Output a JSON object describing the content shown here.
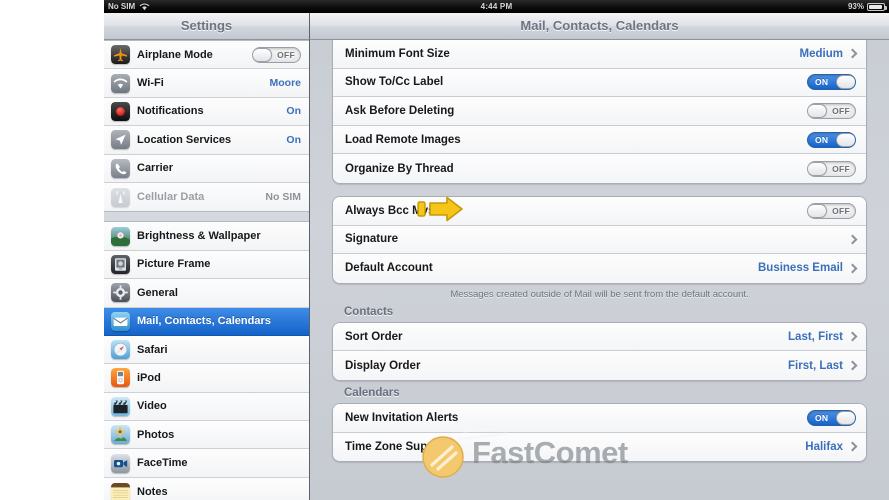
{
  "statusbar": {
    "carrier": "No SIM",
    "wifi_icon": "wifi-icon",
    "time": "4:44 PM",
    "battery_percent": "93%",
    "battery_icon": "battery-icon"
  },
  "nav": {
    "left_title": "Settings",
    "right_title": "Mail, Contacts, Calendars"
  },
  "sidebar": {
    "groups": [
      {
        "items": [
          {
            "label": "Airplane Mode",
            "icon": "airplane-icon",
            "control": "toggle",
            "toggle": "OFF"
          },
          {
            "label": "Wi-Fi",
            "icon": "wifi-icon",
            "control": "value",
            "value": "Moore"
          },
          {
            "label": "Notifications",
            "icon": "notifications-icon",
            "control": "value",
            "value": "On"
          },
          {
            "label": "Location Services",
            "icon": "location-icon",
            "control": "value",
            "value": "On"
          },
          {
            "label": "Carrier",
            "icon": "carrier-phone-icon",
            "control": "none",
            "value": ""
          },
          {
            "label": "Cellular Data",
            "icon": "cellular-data-icon",
            "control": "value",
            "value": "No SIM",
            "dim": true
          }
        ]
      },
      {
        "items": [
          {
            "label": "Brightness & Wallpaper",
            "icon": "brightness-wallpaper-icon",
            "control": "none",
            "value": ""
          },
          {
            "label": "Picture Frame",
            "icon": "picture-frame-icon",
            "control": "none",
            "value": ""
          },
          {
            "label": "General",
            "icon": "general-gear-icon",
            "control": "none",
            "value": ""
          },
          {
            "label": "Mail, Contacts, Calendars",
            "icon": "mail-icon",
            "control": "none",
            "value": "",
            "selected": true
          },
          {
            "label": "Safari",
            "icon": "safari-icon",
            "control": "none",
            "value": ""
          },
          {
            "label": "iPod",
            "icon": "ipod-icon",
            "control": "none",
            "value": ""
          },
          {
            "label": "Video",
            "icon": "video-icon",
            "control": "none",
            "value": ""
          },
          {
            "label": "Photos",
            "icon": "photos-icon",
            "control": "none",
            "value": ""
          },
          {
            "label": "FaceTime",
            "icon": "facetime-icon",
            "control": "none",
            "value": ""
          },
          {
            "label": "Notes",
            "icon": "notes-icon",
            "control": "none",
            "value": ""
          }
        ]
      }
    ]
  },
  "pane": {
    "mail_group_1": [
      {
        "label": "Minimum Font Size",
        "type": "value",
        "value": "Medium"
      },
      {
        "label": "Show To/Cc Label",
        "type": "toggle",
        "toggle": "ON"
      },
      {
        "label": "Ask Before Deleting",
        "type": "toggle",
        "toggle": "OFF"
      },
      {
        "label": "Load Remote Images",
        "type": "toggle",
        "toggle": "ON"
      },
      {
        "label": "Organize By Thread",
        "type": "toggle",
        "toggle": "OFF"
      }
    ],
    "mail_group_2": [
      {
        "label": "Always Bcc Myself",
        "type": "toggle",
        "toggle": "OFF",
        "annotated": true
      },
      {
        "label": "Signature",
        "type": "value",
        "value": ""
      },
      {
        "label": "Default Account",
        "type": "value",
        "value": "Business Email"
      }
    ],
    "footnote": "Messages created outside of Mail will be sent from the default account.",
    "contacts_header": "Contacts",
    "contacts_rows": [
      {
        "label": "Sort Order",
        "type": "value",
        "value": "Last, First"
      },
      {
        "label": "Display Order",
        "type": "value",
        "value": "First, Last"
      }
    ],
    "calendars_header": "Calendars",
    "calendars_rows": [
      {
        "label": "New Invitation Alerts",
        "type": "toggle",
        "toggle": "ON"
      },
      {
        "label": "Time Zone Support",
        "type": "value",
        "value": "Halifax"
      }
    ]
  },
  "annotation": {
    "arrow_color": "#f2c01e",
    "arrow_name": "yellow-pointer-arrow"
  },
  "watermark": {
    "text": "FastComet",
    "logo": "comet-logo",
    "logo_color": "#f5c96a",
    "text_color": "#787c82"
  },
  "colors": {
    "accent_blue": "#1463c9",
    "value_blue": "#3c6fba",
    "pane_bg": "#cbcfd6"
  }
}
